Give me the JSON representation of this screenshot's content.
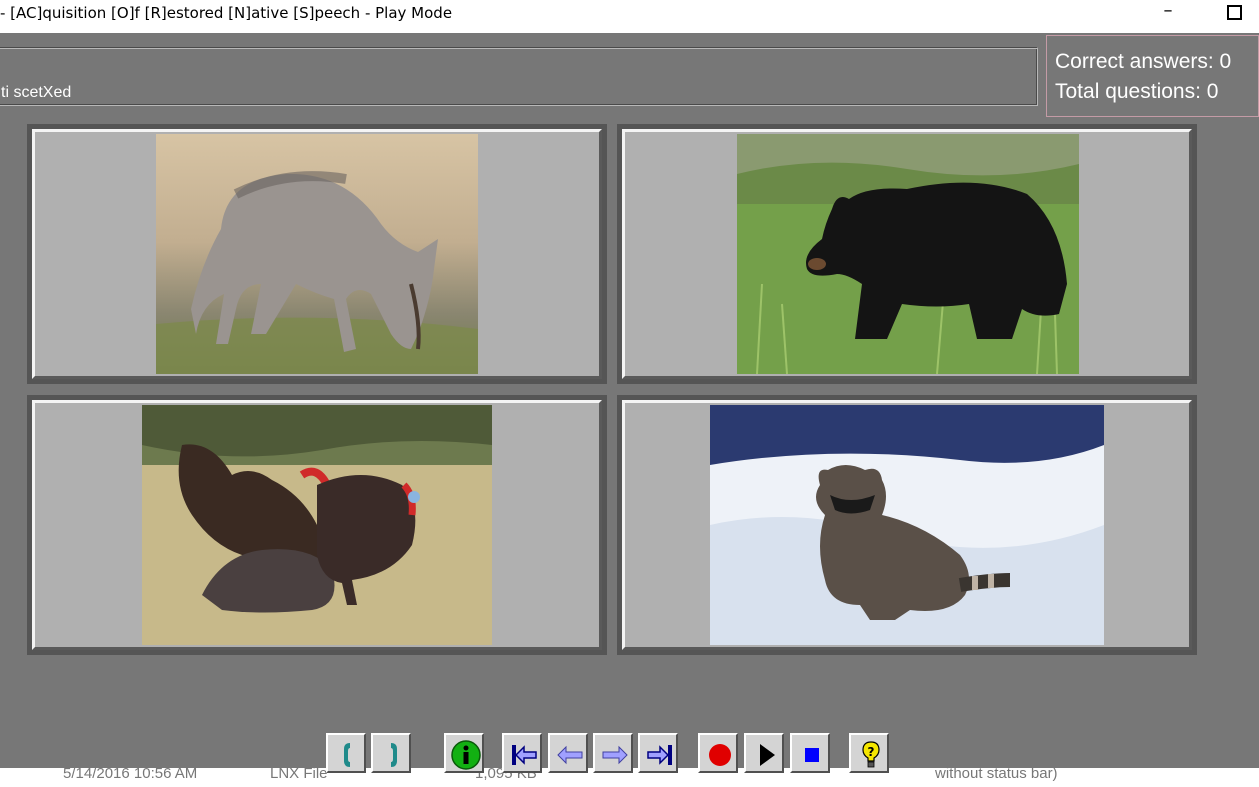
{
  "window": {
    "title": "- [AC]quisition [O]f [R]estored [N]ative [S]peech - Play Mode",
    "minimize_glyph": "–"
  },
  "prompt": {
    "text": "ti scetXed"
  },
  "score": {
    "correct_label": "Correct answers: 0",
    "total_label": "Total questions: 0"
  },
  "tiles": [
    {
      "animal": "coyote"
    },
    {
      "animal": "black bear"
    },
    {
      "animal": "wild turkeys"
    },
    {
      "animal": "raccoon"
    }
  ],
  "statusbar": {
    "date": "5/14/2016 10:56 AM",
    "type": "LNX File",
    "size": "1,095 KB",
    "note": "without status bar)"
  },
  "toolbar": [
    {
      "icon": "phone-up-icon"
    },
    {
      "icon": "phone-down-icon"
    },
    {
      "icon": "info-icon"
    },
    {
      "icon": "first-icon"
    },
    {
      "icon": "previous-icon"
    },
    {
      "icon": "next-icon"
    },
    {
      "icon": "last-icon"
    },
    {
      "icon": "record-icon"
    },
    {
      "icon": "play-icon"
    },
    {
      "icon": "stop-icon"
    },
    {
      "icon": "help-icon"
    }
  ],
  "colors": {
    "background": "#777777",
    "tile_fill": "#b0b0b0",
    "record": "#e00000",
    "stop": "#0000ff",
    "info": "#12b012",
    "arrows": "#a0a0ff"
  }
}
